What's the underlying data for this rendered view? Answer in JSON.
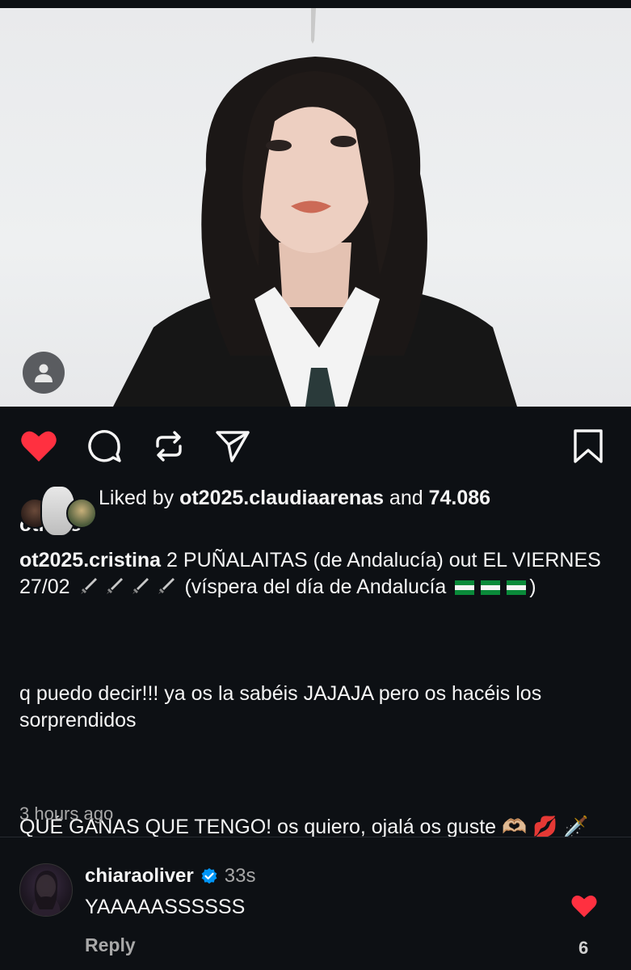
{
  "post": {
    "liked_by_prefix": "Liked by ",
    "liked_by_user": "ot2025.claudiaarenas",
    "liked_by_middle": " and ",
    "liked_by_count": "74.086",
    "liked_by_suffix": " others",
    "caption_user": "ot2025.cristina",
    "caption_line1_a": " 2 PUÑALAITAS (de Andalucía) out EL VIERNES 27/02 ",
    "caption_line1_b": " (víspera del día de Andalucía ",
    "caption_line1_c": ")",
    "caption_para2": "q puedo decir!!! ya os la sabéis JAJAJA pero os hacéis los sorprendidos",
    "caption_para3": "QUÉ GANAS QUE TENGO! os quiero, ojalá os guste 🫶🏼 💋 🗡️",
    "time": "3 hours ago"
  },
  "comment": {
    "user": "chiaraoliver",
    "time": "33s",
    "text": "YAAAAASSSSSS",
    "reply_label": "Reply",
    "like_count": "6"
  },
  "icons": {
    "like": "heart-filled-icon",
    "comment": "comment-icon",
    "repost": "repost-icon",
    "share": "send-icon",
    "save": "bookmark-icon",
    "user_tag": "person-icon",
    "verified": "verified-badge-icon"
  },
  "colors": {
    "background": "#0d1014",
    "like_red": "#ff3040",
    "verified_blue": "#0095f6",
    "secondary_text": "#a8a8a8"
  }
}
